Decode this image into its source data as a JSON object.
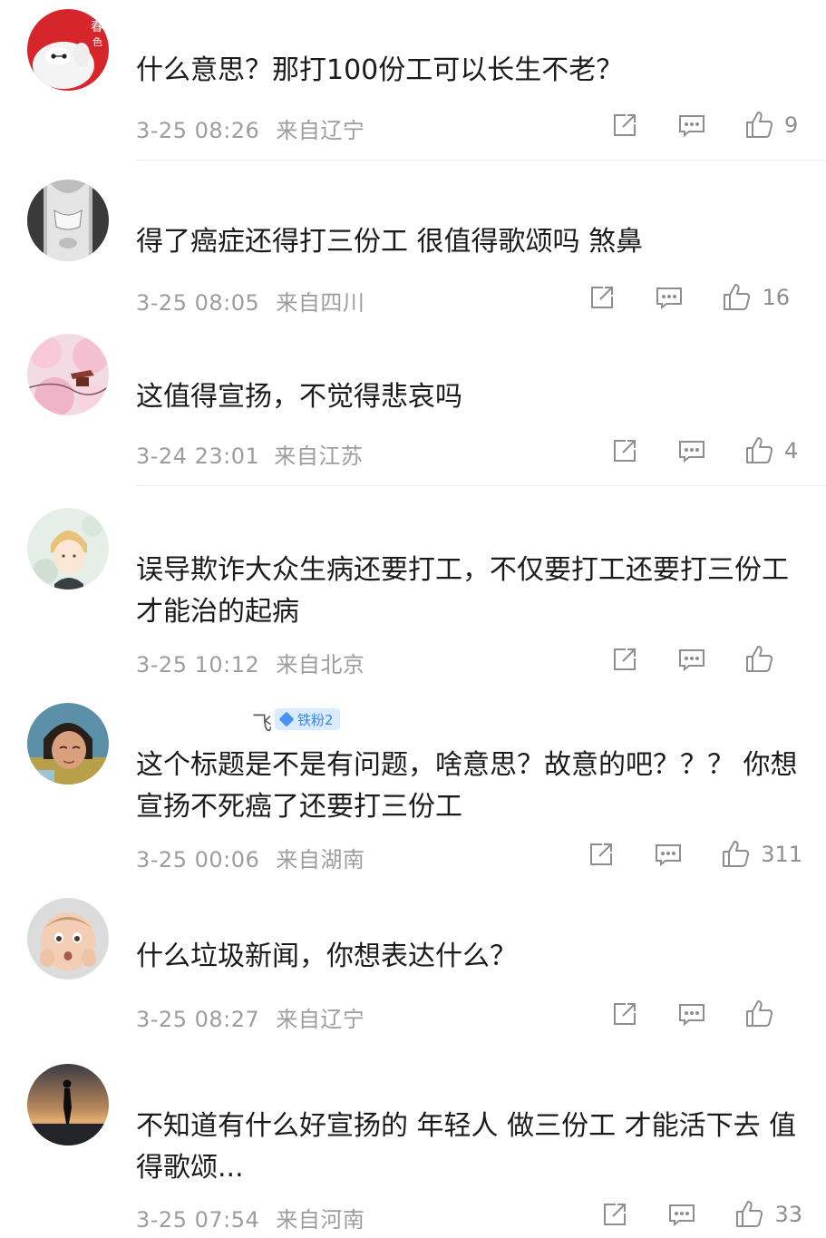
{
  "comments": [
    {
      "username": "春色",
      "text": "什么意思？那打100份工可以长生不老？",
      "time": "3-25 08:26",
      "location": "来自辽宁",
      "likes": "9",
      "avatar": "red-robot"
    },
    {
      "username": "",
      "text": "得了癌症还得打三份工 很值得歌颂吗 煞鼻",
      "time": "3-25 08:05",
      "location": "来自四川",
      "likes": "16",
      "avatar": "grey-portrait"
    },
    {
      "username": "",
      "text": "这值得宣扬，不觉得悲哀吗",
      "time": "3-24 23:01",
      "location": "来自江苏",
      "likes": "4",
      "avatar": "cherry-blossom"
    },
    {
      "username": "",
      "text": "误导欺诈大众生病还要打工，不仅要打工还要打三份工才能治的起病",
      "time": "3-25 10:12",
      "location": "来自北京",
      "likes": "",
      "avatar": "anime-boy"
    },
    {
      "username": "飞",
      "badge": "铁粉2",
      "text": "这个标题是不是有问题，啥意思？故意的吧？？？ 你想宣扬不死癌了还要打三份工",
      "time": "3-25 00:06",
      "location": "来自湖南",
      "likes": "311",
      "avatar": "child-photo"
    },
    {
      "username": "",
      "text": "什么垃圾新闻，你想表达什么？",
      "time": "3-25 08:27",
      "location": "来自辽宁",
      "likes": "",
      "avatar": "baby-photo"
    },
    {
      "username": "",
      "text": "不知道有什么好宣扬的 年轻人 做三份工 才能活下去 值得歌颂...",
      "time": "3-25 07:54",
      "location": "来自河南",
      "likes": "33",
      "avatar": "sunset-silhouette"
    }
  ],
  "colors": {
    "text": "#1b1b1b",
    "meta": "#9d9d9d",
    "icon": "#8e8e8e",
    "badge_bg": "#d9ebff",
    "badge_fg": "#3a86ef"
  },
  "icons": [
    "share-icon",
    "comment-icon",
    "like-icon"
  ]
}
